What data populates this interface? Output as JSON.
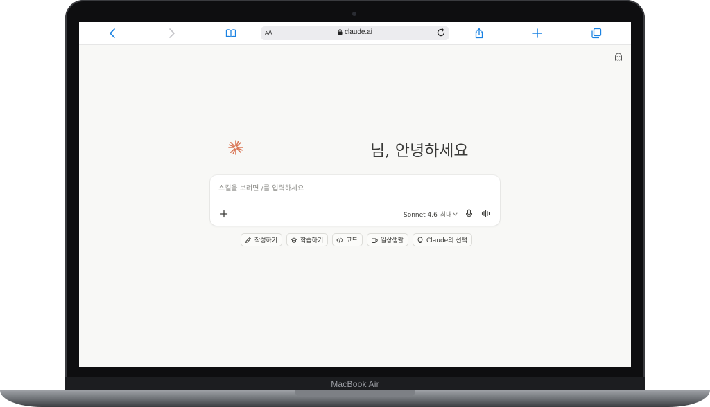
{
  "device": {
    "model_label": "MacBook Air"
  },
  "browser": {
    "url": "claude.ai",
    "text_size_label": "AA",
    "toolbar": {
      "back_icon": "chevron-left-icon",
      "forward_icon": "chevron-right-icon",
      "bookmarks_icon": "book-icon",
      "reload_icon": "reload-icon",
      "share_icon": "share-icon",
      "new_tab_icon": "plus-icon",
      "tabs_icon": "tabs-icon"
    }
  },
  "page": {
    "incognito_icon": "ghost-icon",
    "greeting": "님, 안녕하세요",
    "logo_icon": "claude-starburst-icon",
    "accent_color": "#d97757",
    "composer": {
      "placeholder": "스킬을 보려면 /를 입력하세요",
      "model": "Sonnet 4.6",
      "effort": "최대",
      "add_icon": "plus-icon",
      "mic_icon": "microphone-icon",
      "voice_icon": "voice-waveform-icon"
    },
    "chips": [
      {
        "label": "작성하기",
        "icon": "pencil-icon"
      },
      {
        "label": "학습하기",
        "icon": "graduation-cap-icon"
      },
      {
        "label": "코드",
        "icon": "code-icon"
      },
      {
        "label": "일상생활",
        "icon": "coffee-cup-icon"
      },
      {
        "label": "Claude의 선택",
        "icon": "lightbulb-icon"
      }
    ]
  }
}
